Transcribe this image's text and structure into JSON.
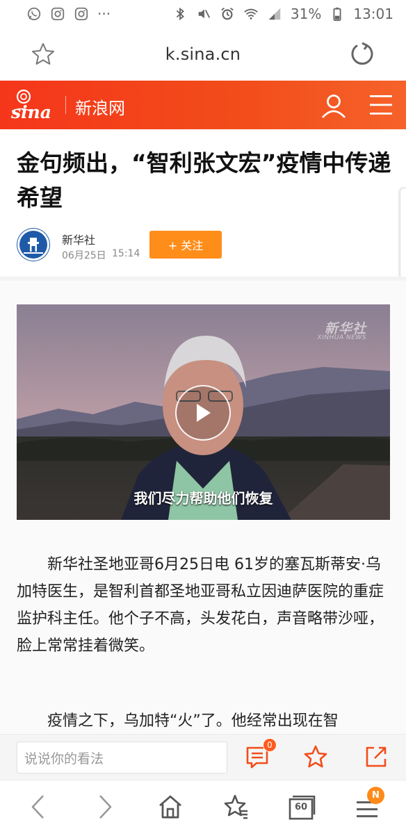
{
  "status_bar": {
    "battery": "31%",
    "time": "13:01",
    "more": "···"
  },
  "address_bar": {
    "url": "k.sina.cn"
  },
  "site_header": {
    "logo_text": "sina",
    "site_name": "新浪网",
    "brand_color": "#f5361b"
  },
  "article": {
    "headline": "金句频出，“智利张文宏”疫情中传递希望",
    "author": "新华社",
    "date": "06月25日",
    "time": "15:14",
    "follow_label": "+ 关注",
    "paragraphs": [
      "新华社圣地亚哥6月25日电 61岁的塞瓦斯蒂安·乌加特医生，是智利首都圣地亚哥私立因迪萨医院的重症监护科主任。他个子不高，头发花白，声音略带沙哑，脸上常常挂着微笑。",
      "疫情之下，乌加特“火”了。他经常出现在智"
    ]
  },
  "video": {
    "watermark_cn": "新华社",
    "watermark_en": "XINHUA NEWS",
    "subtitle": "我们尽力帮助他们恢复"
  },
  "comment_bar": {
    "placeholder": "说说你的看法",
    "comment_count": "0"
  },
  "browser_nav": {
    "tabs_count": "60",
    "menu_badge": "N"
  },
  "colors": {
    "follow_button": "#ff8d1a",
    "icon_accent": "#f24d1a"
  }
}
